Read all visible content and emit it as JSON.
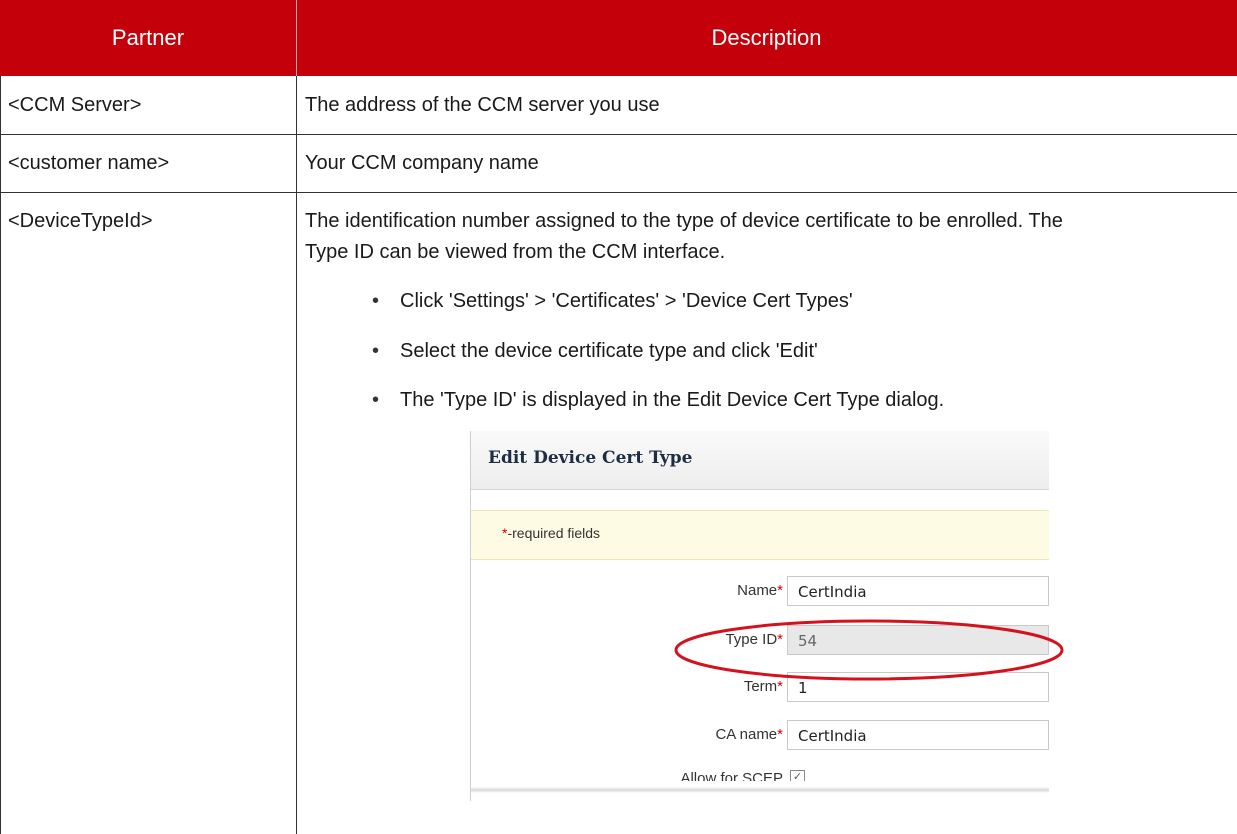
{
  "header": {
    "col_partner": "Partner",
    "col_description": "Description"
  },
  "rows": [
    {
      "partner": "<CCM Server>",
      "description": "The address of the CCM server you use"
    },
    {
      "partner": "<customer name>",
      "description": "Your CCM company name"
    },
    {
      "partner": "<DeviceTypeId>",
      "description_line1": "The identification number assigned to the type of device certificate to be enrolled. The",
      "description_line2": "Type ID can be viewed from the CCM interface.",
      "bullets": [
        "Click 'Settings' > 'Certificates' > 'Device Cert Types'",
        "Select the device certificate type and click 'Edit'",
        "The 'Type ID' is displayed in the Edit Device Cert Type dialog."
      ]
    }
  ],
  "bullet_glyph": "•",
  "dialog": {
    "title": "Edit Device Cert Type",
    "required_star": "*",
    "required_text": "-required fields",
    "fields": [
      {
        "label": "Name",
        "value": "CertIndia",
        "disabled": false
      },
      {
        "label": "Type ID",
        "value": "54",
        "disabled": true
      },
      {
        "label": "Term",
        "value": "1",
        "disabled": false
      },
      {
        "label": "CA name",
        "value": "CertIndia",
        "disabled": false
      }
    ],
    "checkbox_label": "Allow for SCEP",
    "checkbox_checked": true,
    "star": "*"
  },
  "colors": {
    "header_bg": "#c4000a",
    "highlight_ellipse": "#d4121e"
  }
}
